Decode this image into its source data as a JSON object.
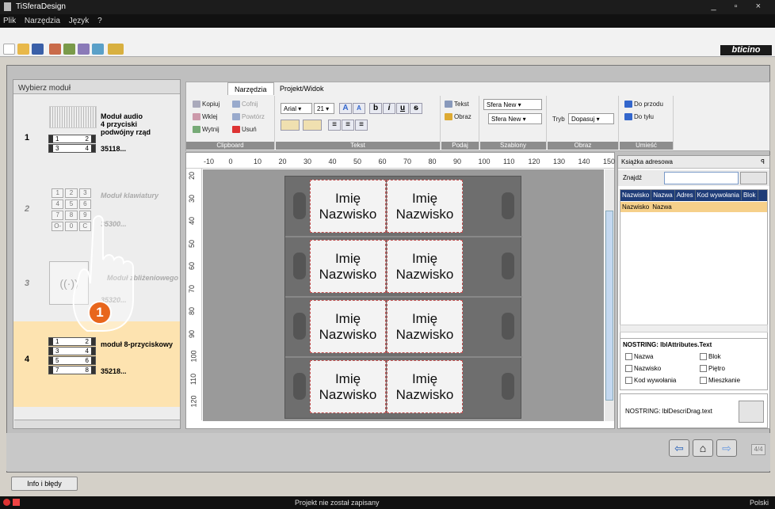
{
  "window": {
    "title": "TiSferaDesign"
  },
  "menu": [
    "Plik",
    "Narzędzia",
    "Język",
    "?"
  ],
  "brand": {
    "logo_text": "bticino"
  },
  "left_panel": {
    "header": "Wybierz moduł",
    "modules": [
      {
        "index": "1",
        "name_lines": [
          "Moduł audio",
          "4 przyciski",
          "podwójny rząd"
        ],
        "code": "35118...",
        "buttons": [
          [
            "1",
            "2"
          ],
          [
            "3",
            "4"
          ]
        ]
      },
      {
        "index": "2",
        "name": "Moduł klawiatury",
        "code": "35300...",
        "keys": [
          "1",
          "2",
          "3",
          "4",
          "5",
          "6",
          "7",
          "8",
          "9",
          "O-",
          "0",
          "C"
        ]
      },
      {
        "index": "3",
        "name": "Moduł zbliżeniowego",
        "code": "35320..."
      },
      {
        "index": "4",
        "name": "moduł 8-przyciskowy",
        "code": "35218...",
        "buttons": [
          [
            "1",
            "2"
          ],
          [
            "3",
            "4"
          ],
          [
            "5",
            "6"
          ],
          [
            "7",
            "8"
          ]
        ]
      }
    ]
  },
  "ribbon": {
    "tabs": [
      "Narzędzia",
      "Projekt/Widok"
    ],
    "clipboard": {
      "label": "Clipboard",
      "copy": "Kopiuj",
      "undo": "Cofnij",
      "paste": "Wklej",
      "redo": "Powtórz",
      "cut": "Wytnij",
      "delete": "Usuń"
    },
    "text": {
      "label": "Tekst",
      "font": "Arial",
      "size": "21",
      "bold": "b",
      "italic": "i",
      "underline": "u",
      "strike": "s",
      "grow": "A",
      "shrink": "A"
    },
    "insert": {
      "label": "Podaj",
      "text": "Tekst",
      "image": "Obraz"
    },
    "templates": {
      "label": "Szablony",
      "value1": "Sfera New",
      "value2": "Sfera New"
    },
    "image": {
      "label": "Obraz",
      "mode_label": "Tryb",
      "mode": "Dopasuj"
    },
    "arrange": {
      "label": "Umieść",
      "front": "Do przodu",
      "back": "Do tyłu"
    }
  },
  "ruler": {
    "h": [
      "-10",
      "0",
      "10",
      "20",
      "30",
      "40",
      "50",
      "60",
      "70",
      "80",
      "90",
      "100",
      "110",
      "120",
      "130",
      "140",
      "150"
    ],
    "v": [
      "20",
      "30",
      "40",
      "50",
      "60",
      "70",
      "80",
      "90",
      "100",
      "110",
      "120"
    ]
  },
  "panel_cards": [
    [
      "Imię",
      "Nazwisko",
      "Imię",
      "Nazwisko"
    ],
    [
      "Imię",
      "Nazwisko",
      "Imię",
      "Nazwisko"
    ],
    [
      "Imię",
      "Nazwisko",
      "Imię",
      "Nazwisko"
    ],
    [
      "Imię",
      "Nazwisko",
      "Imię",
      "Nazwisko"
    ]
  ],
  "address_book": {
    "title": "Książka adresowa",
    "pin": "ꟼ",
    "find_label": "Znajdź",
    "columns": [
      "Nazwisko",
      "Nazwa",
      "Adres",
      "Kod wywołania",
      "Blok"
    ],
    "row": [
      "Nazwisko",
      "Nazwa"
    ],
    "attrs_title": "NOSTRING: lblAttributes.Text",
    "attrs": [
      "Nazwa",
      "Blok",
      "Nazwisko",
      "Piętro",
      "Kod wywołania",
      "Mieszkanie"
    ],
    "drag_text": "NOSTRING: lblDescriDrag.text"
  },
  "nav": {
    "pager": "4/4"
  },
  "info_button": "Info i błędy",
  "status": {
    "message": "Projekt nie został zapisany",
    "language": "Polski"
  },
  "badge": "1",
  "colors": {
    "accent": "#f07a1d",
    "selected_module": "#fde3b0",
    "table_header": "#1e3c78"
  }
}
